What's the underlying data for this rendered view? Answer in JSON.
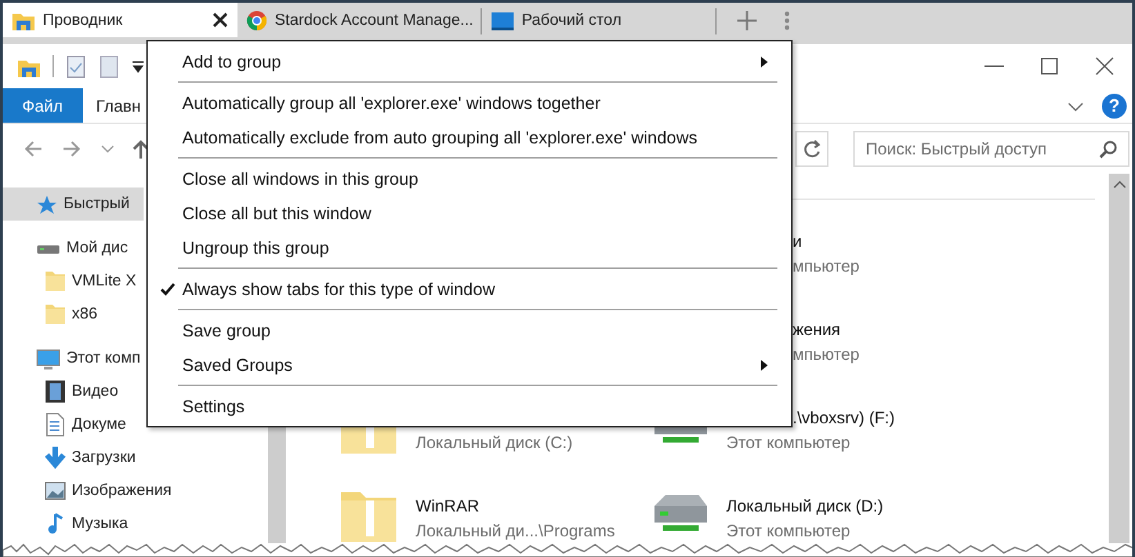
{
  "tabs": [
    {
      "title": "Проводник",
      "selected": true
    },
    {
      "title": "Stardock Account Manage...",
      "selected": false
    },
    {
      "title": "Рабочий стол",
      "selected": false
    }
  ],
  "ribbon_tabs": [
    {
      "label": "Файл",
      "selected": true
    },
    {
      "label": "Главн",
      "selected": false
    }
  ],
  "help_button": "?",
  "search": {
    "placeholder": "Поиск: Быстрый доступ"
  },
  "sidebar": {
    "items": [
      {
        "label": "Быстрый",
        "selected": true
      },
      {
        "label": "Мой дис",
        "selected": false,
        "children": [
          {
            "label": "VMLite X",
            "selected": false
          },
          {
            "label": "x86",
            "selected": false
          }
        ]
      },
      {
        "label": "Этот комп",
        "selected": false,
        "children": [
          {
            "label": "Видео",
            "selected": false
          },
          {
            "label": "Докуме",
            "selected": false
          },
          {
            "label": "Загрузки",
            "selected": false
          },
          {
            "label": "Изображения",
            "selected": false
          },
          {
            "label": "Музыка",
            "selected": false
          }
        ]
      }
    ]
  },
  "content": {
    "left_column": [
      {
        "kind": "detail-only",
        "detail": "Локальный диск (C:)"
      },
      {
        "kind": "open",
        "name": "WinRAR",
        "detail": "Локальный ди...\\Programs"
      }
    ],
    "right_column": [
      {
        "kind": "covered",
        "name": "и",
        "detail": "мпьютер"
      },
      {
        "kind": "covered",
        "name": "жения",
        "detail": "мпьютер"
      },
      {
        "kind": "half-covered",
        "name": ".\\vboxsrv) (F:)",
        "detail": "Этот компьютер"
      },
      {
        "kind": "open",
        "name": "Локальный диск (D:)",
        "detail": "Этот компьютер"
      }
    ]
  },
  "context_menu": {
    "items": [
      {
        "kind": "item",
        "label": "Add to group",
        "submenu": true,
        "checked": false
      },
      {
        "kind": "separator"
      },
      {
        "kind": "item",
        "label": "Automatically group all 'explorer.exe' windows together",
        "submenu": false,
        "checked": false
      },
      {
        "kind": "item",
        "label": "Automatically exclude from auto grouping all 'explorer.exe' windows",
        "submenu": false,
        "checked": false
      },
      {
        "kind": "separator"
      },
      {
        "kind": "item",
        "label": "Close all windows in this group",
        "submenu": false,
        "checked": false
      },
      {
        "kind": "item",
        "label": "Close all but this window",
        "submenu": false,
        "checked": false
      },
      {
        "kind": "item",
        "label": "Ungroup this group",
        "submenu": false,
        "checked": false
      },
      {
        "kind": "separator"
      },
      {
        "kind": "item",
        "label": "Always show tabs for this type of window",
        "submenu": false,
        "checked": true
      },
      {
        "kind": "separator"
      },
      {
        "kind": "item",
        "label": "Save group",
        "submenu": false,
        "checked": false
      },
      {
        "kind": "item",
        "label": "Saved Groups",
        "submenu": true,
        "checked": false
      },
      {
        "kind": "separator"
      },
      {
        "kind": "item",
        "label": "Settings",
        "submenu": false,
        "checked": false
      }
    ]
  }
}
